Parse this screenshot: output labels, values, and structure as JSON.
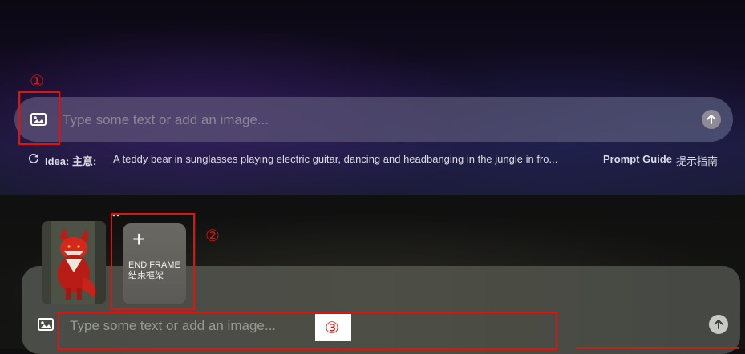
{
  "top_composer": {
    "placeholder": "Type some text or add an image...",
    "idea_label": "Idea: 主意:",
    "idea_text": "A teddy bear in sunglasses playing electric guitar, dancing and headbanging in the jungle in fro...",
    "prompt_guide_label": "Prompt Guide",
    "prompt_guide_cn": "提示指南",
    "icons": [
      "image-upload-icon",
      "send-arrow-icon",
      "refresh-icon"
    ]
  },
  "bottom_composer": {
    "placeholder": "Type some text or add an image...",
    "end_frame_plus": "+",
    "end_frame_label": "END FRAME 结束框架",
    "icons": [
      "image-upload-icon",
      "send-arrow-icon",
      "plus-icon"
    ]
  },
  "annotations": {
    "marker_1": "①",
    "marker_2": "②",
    "marker_3": "③"
  },
  "colors": {
    "annotation_red": "#e3120b",
    "top_bar": "#5f5278",
    "bottom_bar": "#4a4c47"
  }
}
